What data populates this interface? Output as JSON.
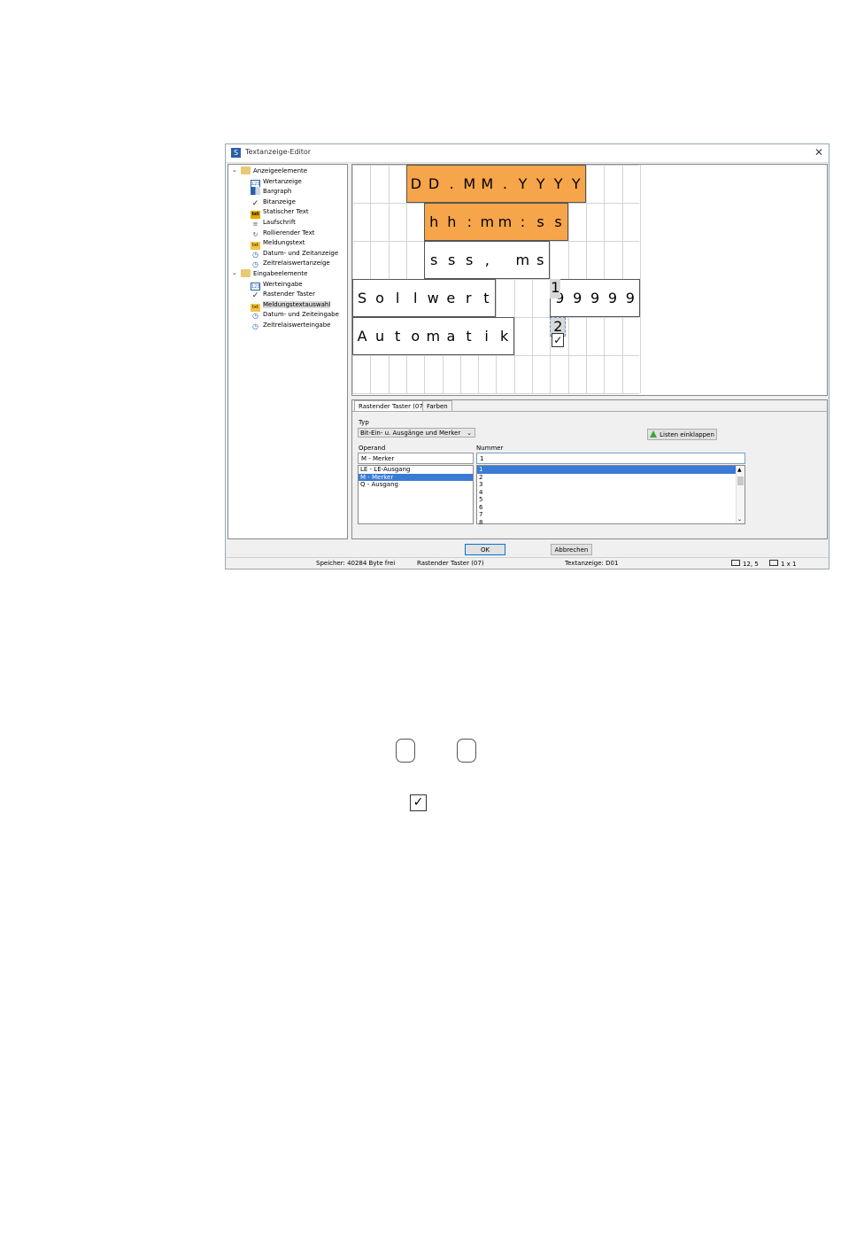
{
  "window": {
    "title": "Textanzeige-Editor",
    "app_icon": "editor-app-icon",
    "close_glyph": "✕"
  },
  "tree": {
    "groups": [
      {
        "label": "Anzeigeelemente",
        "items": [
          {
            "label": "Wertanzeige",
            "icon": "value-display-icon"
          },
          {
            "label": "Bargraph",
            "icon": "bargraph-icon"
          },
          {
            "label": "Bitanzeige",
            "icon": "check-icon"
          },
          {
            "label": "Statischer Text",
            "icon": "text-icon"
          },
          {
            "label": "Laufschrift",
            "icon": "scroll-text-icon"
          },
          {
            "label": "Rollierender Text",
            "icon": "rolling-text-icon"
          },
          {
            "label": "Meldungstext",
            "icon": "message-text-icon"
          },
          {
            "label": "Datum- und Zeitanzeige",
            "icon": "clock-icon"
          },
          {
            "label": "Zeitrelaiswertanzeige",
            "icon": "timer-icon"
          }
        ]
      },
      {
        "label": "Eingabeelemente",
        "items": [
          {
            "label": "Werteingabe",
            "icon": "value-input-icon"
          },
          {
            "label": "Rastender Taster",
            "icon": "check-icon"
          },
          {
            "label": "Meldungstextauswahl",
            "icon": "message-select-icon",
            "selected": true
          },
          {
            "label": "Datum- und Zeiteingabe",
            "icon": "clock-icon"
          },
          {
            "label": "Zeitrelaiswerteingabe",
            "icon": "timer-icon"
          }
        ]
      }
    ]
  },
  "canvas": {
    "date_chars": [
      "D",
      "D",
      ".",
      "M",
      "M",
      ".",
      "Y",
      "Y",
      "Y",
      "Y"
    ],
    "time_chars": [
      "h",
      "h",
      ":",
      "m",
      "m",
      ":",
      "s",
      "s"
    ],
    "ms_chars": [
      "s",
      "s",
      "s",
      ",",
      " ",
      "m",
      "s"
    ],
    "sollwert_chars": [
      "S",
      "o",
      "l",
      "l",
      "w",
      "e",
      "r",
      "t"
    ],
    "value_chars": [
      "9",
      "9",
      "9",
      "9",
      "9"
    ],
    "automatik_chars": [
      "A",
      "u",
      "t",
      "o",
      "m",
      "a",
      "t",
      "i",
      "k"
    ],
    "chip_1": "1",
    "chip_2": "2",
    "check_glyph": "✓"
  },
  "props": {
    "tabs": [
      "Rastender Taster (07)",
      "Farben"
    ],
    "typ_label": "Typ",
    "typ_value": "Bit-Ein- u. Ausgänge und Merker",
    "collapse_button": "Listen einklappen",
    "operand_label": "Operand",
    "operand_value": "M - Merker",
    "operand_list": [
      "LE - LE-Ausgang",
      "M - Merker",
      "Q - Ausgang"
    ],
    "operand_selected": 1,
    "nummer_label": "Nummer",
    "nummer_value": "1",
    "nummer_list": [
      "1",
      "2",
      "3",
      "4",
      "5",
      "6",
      "7",
      "8"
    ],
    "nummer_selected": 0
  },
  "buttons": {
    "ok": "OK",
    "cancel": "Abbrechen"
  },
  "status": {
    "memory": "Speicher: 40284 Byte frei",
    "element": "Rastender Taster (07)",
    "display": "Textanzeige: D01",
    "position": "12, 5",
    "size": "1 x 1"
  }
}
